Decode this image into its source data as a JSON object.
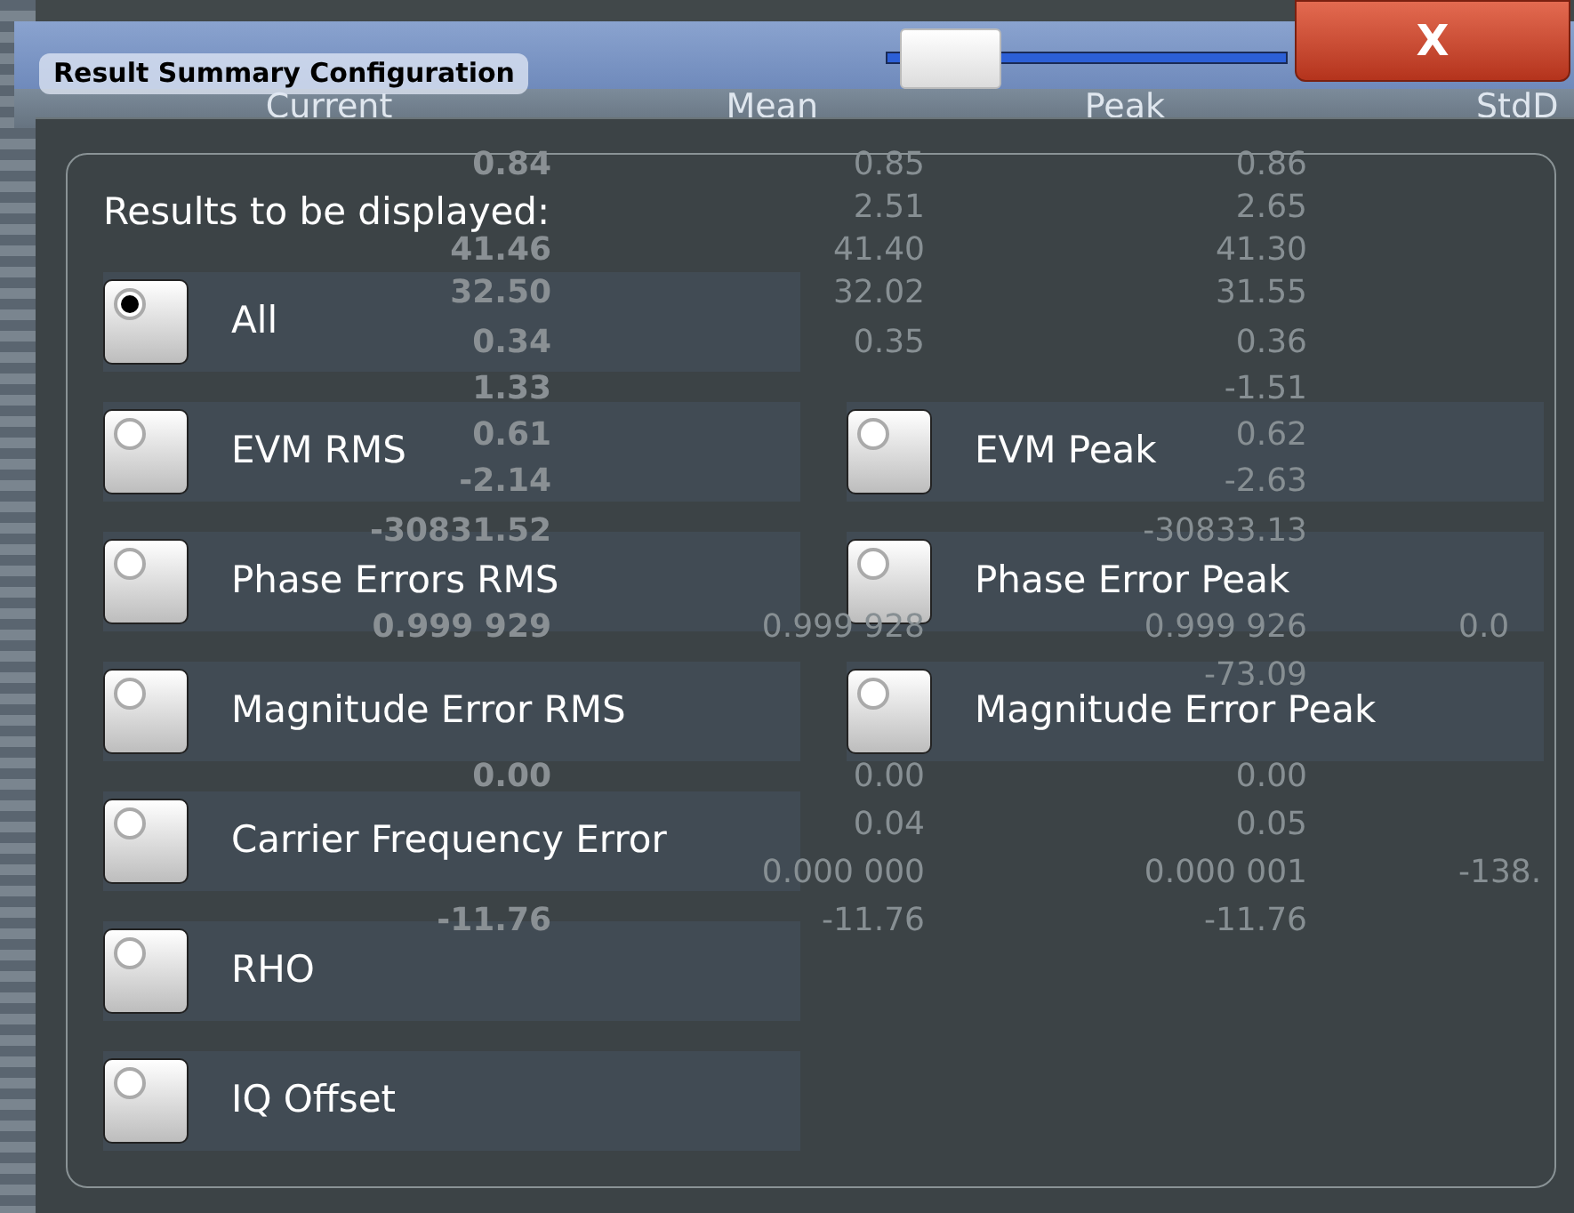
{
  "table": {
    "columns": [
      "Current",
      "Mean",
      "Peak",
      "StdD"
    ],
    "groups": [
      [
        {
          "current": "0.84",
          "mean": "0.85",
          "peak": "0.86"
        },
        {
          "mean": "2.51",
          "peak": "2.65"
        },
        {
          "current": "41.46",
          "mean": "41.40",
          "peak": "41.30"
        },
        {
          "current": "32.50",
          "mean": "32.02",
          "peak": "31.55"
        }
      ],
      [
        {
          "current": "0.34",
          "mean": "0.35",
          "peak": "0.36"
        },
        {
          "current": "1.33",
          "peak": "-1.51"
        },
        {
          "current": "0.61",
          "peak": "0.62"
        },
        {
          "current": "-2.14",
          "peak": "-2.63"
        }
      ],
      [
        {
          "current": "-30831.52",
          "peak": "-30833.13"
        },
        {
          "current": "0.999 929",
          "mean": "0.999 928",
          "peak": "0.999 926",
          "column_4": "0.0"
        },
        {
          "peak": "-73.09"
        }
      ],
      [
        {
          "current": "0.00",
          "mean": "0.00",
          "peak": "0.00"
        },
        {
          "mean": "0.04",
          "peak": "0.05"
        },
        {
          "mean": "0.000 000",
          "peak": "0.000 001",
          "column_4": "-138."
        },
        {
          "current": "-11.76",
          "mean": "-11.76",
          "peak": "-11.76"
        }
      ]
    ]
  },
  "dialog": {
    "title": "Result Summary Configuration",
    "transparency_slider": {
      "level": 0.05
    },
    "close_button": "X",
    "group_label": "Results to be displayed:",
    "option_rows": [
      [
        {
          "label": "All",
          "selected": true
        }
      ],
      [
        {
          "label": "EVM RMS",
          "selected": false
        },
        {
          "label": "EVM Peak",
          "selected": false
        }
      ],
      [
        {
          "label": "Phase Errors RMS",
          "selected": false
        },
        {
          "label": "Phase Error Peak",
          "selected": false
        }
      ],
      [
        {
          "label": "Magnitude Error RMS",
          "selected": false
        },
        {
          "label": "Magnitude Error Peak",
          "selected": false
        }
      ],
      [
        {
          "label": "Carrier Frequency Error",
          "selected": false
        }
      ],
      [
        {
          "label": "RHO",
          "selected": false
        }
      ],
      [
        {
          "label": "IQ Offset",
          "selected": false
        }
      ]
    ]
  }
}
